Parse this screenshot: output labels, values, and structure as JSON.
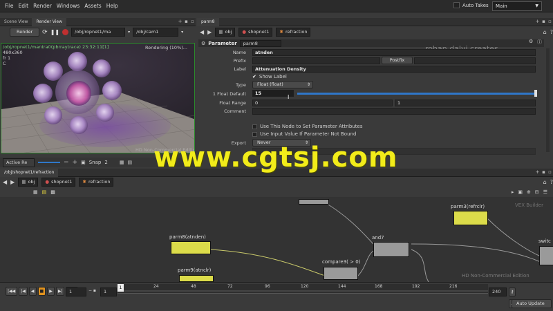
{
  "menu": [
    "File",
    "Edit",
    "Render",
    "Windows",
    "Assets",
    "Help"
  ],
  "auto_takes_label": "Auto Takes",
  "desktop": "Main",
  "scene_tabs": [
    "Scene View",
    "Render View"
  ],
  "render_toolbar": {
    "render_button": "Render",
    "rop_path": "/obj/ropnet1/ma",
    "cam_path": "/obj/cam1"
  },
  "viewer": {
    "overlay_path": "/obj/ropnet1/mantra0(pbrraytrace)",
    "overlay_time": "23:32:11[1]",
    "resolution": "480x360",
    "frame": "fr 1",
    "channel": "C",
    "status": "Rendering (10%)..."
  },
  "viewer_bottom": {
    "active_label": "Active Re",
    "snap_label": "Snap",
    "snap_value": "2"
  },
  "param_tabs": [
    "parm8"
  ],
  "param_path": [
    "obj",
    "shopnet1",
    "refraction"
  ],
  "param_header": {
    "type_label": "Parameter",
    "node_name": "parm8"
  },
  "params": {
    "name_label": "Name",
    "name_value": "atnden",
    "prefix_label": "Prefix",
    "postfix_button": "Postfix",
    "label_label": "Label",
    "label_value": "Attenuation Density",
    "show_label": "Show Label",
    "type_label": "Type",
    "type_value": "Float (float)",
    "default_label": "1 Float Default",
    "default_value": "15",
    "range_label": "Float Range",
    "range_min": "0",
    "range_max": "1",
    "comment_label": "Comment",
    "attr_option": "Use This Node to Set Parameter Attributes",
    "input_option": "Use Input Value If Parameter Not Bound",
    "export_label": "Export",
    "export_value": "Never"
  },
  "network_tabs": [
    "/obj/shopnet1/refraction"
  ],
  "network_path": [
    "obj",
    "shopnet1",
    "refraction"
  ],
  "network": {
    "nodes": [
      {
        "label": "parm8(atnden)"
      },
      {
        "label": "parm9(atnclr)"
      },
      {
        "label": "compare3( > 0)"
      },
      {
        "label": "and7"
      },
      {
        "label": "parm3(refrclr)"
      },
      {
        "label": "switc"
      }
    ],
    "corner_label": "VEX Builder"
  },
  "watermarks": {
    "brand": "rohan dalvi creates",
    "site": "www.cgtsj.com",
    "viewer_edition": "HD Non-Commercial Edition",
    "network_edition": "HD Non-Commercial Edition"
  },
  "timeline": {
    "ticks": [
      "24",
      "48",
      "72",
      "96",
      "120",
      "144",
      "168",
      "192",
      "216"
    ],
    "start_marker": "1",
    "current_frame": "1",
    "start_frame": "1",
    "end_frame": "240",
    "auto_update": "Auto Update"
  }
}
